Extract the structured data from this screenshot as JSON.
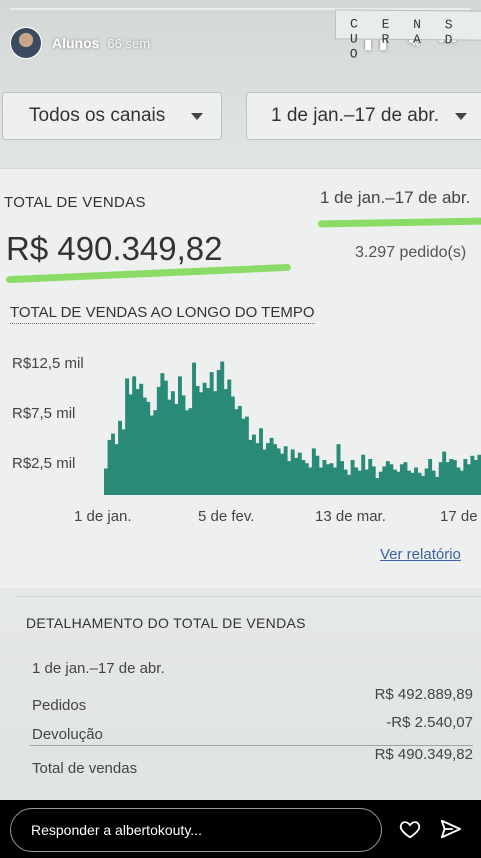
{
  "story": {
    "username": "Alunos",
    "time_ago": "66 sem",
    "censor_text": "C E N S U R A D O",
    "reply_placeholder": "Responder a albertokouty..."
  },
  "filters": {
    "channels": "Todos os canais",
    "date_range": "1 de jan.–17 de abr."
  },
  "summary": {
    "total_label": "TOTAL DE VENDAS",
    "date_range": "1 de jan.–17 de abr.",
    "total_value": "R$ 490.349,82",
    "orders": "3.297 pedido(s)"
  },
  "chart_data": {
    "type": "bar",
    "title": "TOTAL DE VENDAS AO LONGO DO TEMPO",
    "y_ticks": [
      "R$12,5 mil",
      "R$7,5 mil",
      "R$2,5 mil"
    ],
    "x_ticks": [
      "1 de jan.",
      "5 de fev.",
      "13 de mar.",
      "17 de"
    ],
    "ylim": [
      0,
      13.5
    ],
    "values": [
      2.5,
      5.2,
      5.8,
      4.8,
      7.0,
      6.2,
      11.0,
      9.5,
      11.2,
      10.0,
      10.5,
      9.2,
      8.8,
      7.5,
      8.0,
      10.2,
      11.5,
      10.8,
      9.0,
      9.8,
      8.6,
      11.2,
      9.4,
      8.0,
      8.2,
      12.5,
      10.3,
      9.7,
      10.6,
      10.1,
      11.6,
      9.8,
      11.8,
      12.6,
      10.0,
      10.9,
      9.3,
      8.1,
      8.4,
      7.2,
      7.4,
      5.2,
      5.7,
      4.9,
      6.3,
      4.3,
      4.9,
      5.4,
      4.8,
      4.4,
      3.9,
      4.6,
      3.2,
      4.3,
      3.5,
      4.0,
      3.3,
      3.0,
      2.6,
      4.4,
      3.7,
      2.6,
      3.3,
      2.9,
      3.0,
      2.6,
      4.8,
      3.2,
      2.4,
      1.9,
      3.3,
      2.6,
      2.3,
      3.8,
      2.4,
      3.4,
      2.7,
      1.6,
      2.2,
      2.7,
      3.2,
      2.9,
      2.4,
      2.2,
      2.9,
      3.1,
      2.3,
      2.1,
      2.6,
      2.1,
      1.8,
      2.5,
      3.4,
      2.3,
      1.7,
      3.1,
      4.1,
      3.1,
      3.4,
      3.3,
      2.6,
      2.3,
      3.4,
      2.9,
      3.7,
      3.3,
      3.8
    ],
    "color": "#2a8a78"
  },
  "links": {
    "report": "Ver relatório"
  },
  "breakdown": {
    "title": "DETALHAMENTO DO TOTAL DE VENDAS",
    "date_range": "1 de jan.–17 de abr.",
    "rows": [
      {
        "label": "Pedidos",
        "value": "R$ 492.889,89"
      },
      {
        "label": "Devolução",
        "value": "-R$ 2.540,07"
      },
      {
        "label": "Total de vendas",
        "value": "R$ 490.349,82"
      }
    ]
  }
}
